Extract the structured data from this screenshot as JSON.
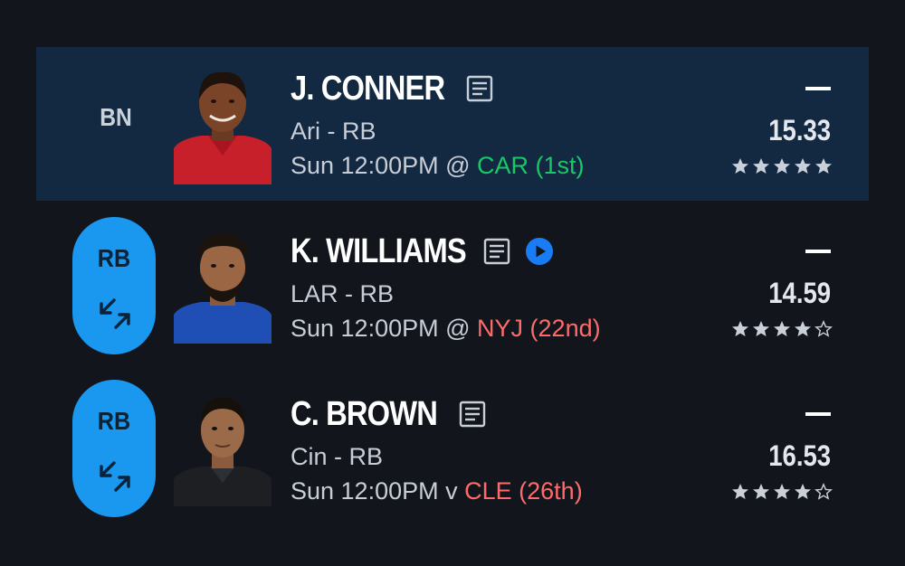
{
  "players": [
    {
      "name": "J. CONNER",
      "team_pos": "Ari - RB",
      "game_prefix": "Sun 12:00PM @ ",
      "opponent": "CAR (1st)",
      "opponent_color": "#17c964",
      "slot": "BN",
      "projection_dash": "—",
      "projection": "15.33",
      "rating": 5,
      "icons": [
        "note-icon"
      ],
      "jersey_color": "#c8202b"
    },
    {
      "name": "K. WILLIAMS",
      "team_pos": "LAR - RB",
      "game_prefix": "Sun 12:00PM @ ",
      "opponent": "NYJ (22nd)",
      "opponent_color": "#ff6b6b",
      "slot": "RB",
      "projection_dash": "—",
      "projection": "14.59",
      "rating": 4,
      "icons": [
        "note-icon",
        "play-icon"
      ],
      "jersey_color": "#1f4fb5"
    },
    {
      "name": "C. BROWN",
      "team_pos": "Cin - RB",
      "game_prefix": "Sun 12:00PM v ",
      "opponent": "CLE (26th)",
      "opponent_color": "#ff6b6b",
      "slot": "RB",
      "projection_dash": "—",
      "projection": "16.53",
      "rating": 4,
      "icons": [
        "note-icon"
      ],
      "jersey_color": "#1d1f22"
    }
  ],
  "colors": {
    "background": "#12161c",
    "highlight_row": "#132841",
    "pill": "#1a97ef"
  }
}
